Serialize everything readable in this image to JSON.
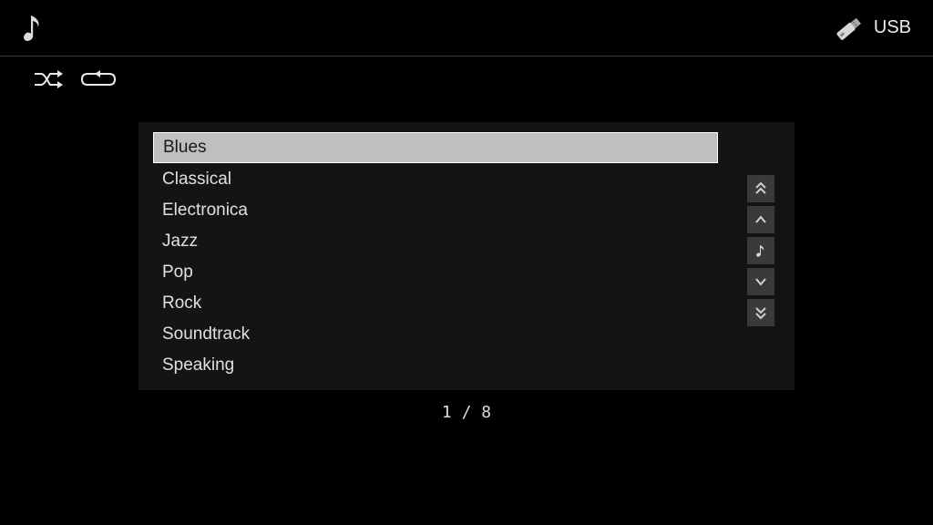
{
  "header": {
    "source_label": "USB"
  },
  "list": {
    "items": [
      {
        "label": "Blues",
        "selected": true
      },
      {
        "label": "Classical",
        "selected": false
      },
      {
        "label": "Electronica",
        "selected": false
      },
      {
        "label": "Jazz",
        "selected": false
      },
      {
        "label": "Pop",
        "selected": false
      },
      {
        "label": "Rock",
        "selected": false
      },
      {
        "label": "Soundtrack",
        "selected": false
      },
      {
        "label": "Speaking",
        "selected": false
      }
    ]
  },
  "pager": {
    "current": "1",
    "separator": " / ",
    "total": "8"
  }
}
